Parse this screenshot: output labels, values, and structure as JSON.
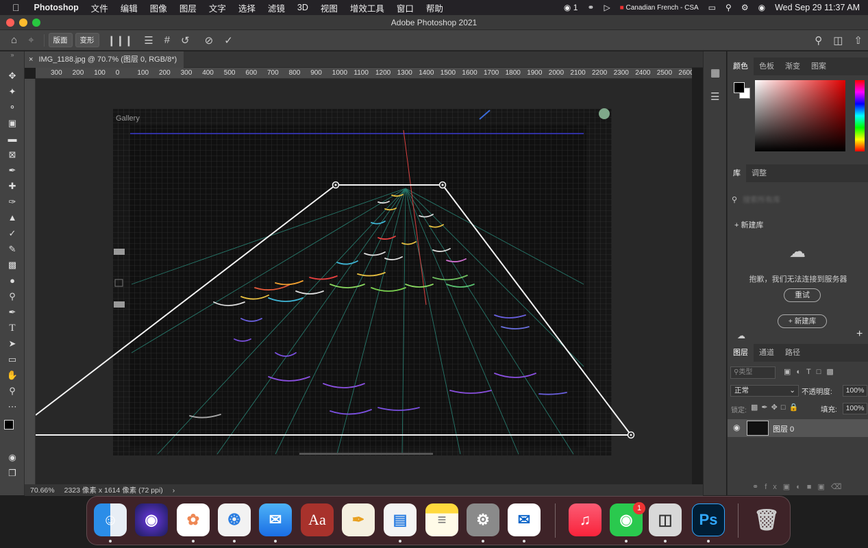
{
  "menubar": {
    "apple": "",
    "items": [
      "Photoshop",
      "文件",
      "编辑",
      "图像",
      "图层",
      "文字",
      "选择",
      "滤镜",
      "3D",
      "视图",
      "增效工具",
      "窗口",
      "帮助"
    ],
    "wechat_count": "1",
    "input_source": "Canadian French - CSA",
    "datetime": "Wed Sep 29  11:37 AM"
  },
  "titlebar": {
    "title": "Adobe Photoshop 2021"
  },
  "options": {
    "btn_layout": "版面",
    "btn_transform": "变形"
  },
  "document": {
    "tab_title": "IMG_1188.jpg @ 70.7% (图层 0, RGB/8*)",
    "close": "×"
  },
  "ruler_h": [
    "300",
    "200",
    "100",
    "0",
    "100",
    "200",
    "300",
    "400",
    "500",
    "600",
    "700",
    "800",
    "900",
    "1000",
    "1100",
    "1200",
    "1300",
    "1400",
    "1500",
    "1600",
    "1700",
    "1800",
    "1900",
    "2000",
    "2100",
    "2200",
    "2300",
    "2400",
    "2500",
    "2600"
  ],
  "canvas": {
    "gallery_label": "Gallery"
  },
  "status": {
    "zoom": "70.66%",
    "doc_info": "2323 像素 x 1614 像素 (72 ppi)",
    "arrow": "›"
  },
  "color_panel": {
    "tabs": [
      "颜色",
      "色板",
      "渐变",
      "图案"
    ]
  },
  "library_panel": {
    "tabs": [
      "库",
      "调整"
    ],
    "search_placeholder": "搜索所有库",
    "new_library": "新建库",
    "error": "抱歉，我们无法连接到服务器",
    "retry": "重试",
    "new_library_btn": "+ 新建库"
  },
  "layers_panel": {
    "tabs": [
      "图层",
      "通道",
      "路径"
    ],
    "kind_placeholder": "类型",
    "blend_mode": "正常",
    "opacity_label": "不透明度:",
    "opacity_value": "100%",
    "lock_label": "锁定:",
    "fill_label": "填充:",
    "fill_value": "100%",
    "layers": [
      {
        "name": "图层 0"
      }
    ]
  },
  "dock": {
    "wechat_badge": "1",
    "dictionary_label": "Aa",
    "ps_label": "Ps"
  }
}
